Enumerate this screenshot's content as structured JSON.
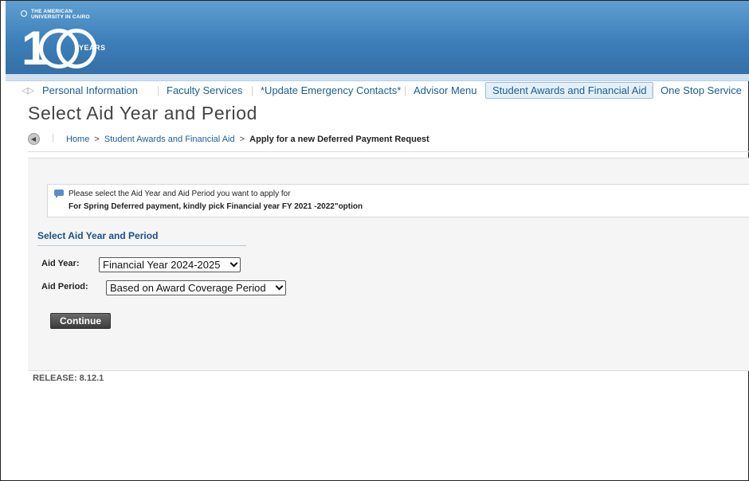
{
  "header": {
    "university_line1": "THE AMERICAN",
    "university_line2": "UNIVERSITY IN CAIRO",
    "centennial_years": "YEARS",
    "brand_color": "#3d7fb9"
  },
  "nav": {
    "items": [
      {
        "label": "Personal Information"
      },
      {
        "label": "Faculty Services"
      },
      {
        "label": "*Update Emergency Contacts*"
      },
      {
        "label": "Advisor Menu"
      },
      {
        "label": "Student Awards and Financial Aid",
        "active": true
      },
      {
        "label": "One Stop Service"
      }
    ]
  },
  "page": {
    "title": "Select Aid Year and Period"
  },
  "breadcrumb": {
    "home": "Home",
    "section": "Student Awards and Financial Aid",
    "current": "Apply for a new Deferred Payment Request",
    "separator": ">"
  },
  "info": {
    "line1": "Please select the Aid Year and Aid Period you want to apply for",
    "line2": "For Spring Deferred payment, kindly pick Financial year FY 2021 -2022\"option"
  },
  "form": {
    "section_title": "Select Aid Year and Period",
    "aid_year": {
      "label": "Aid Year:",
      "selected": "Financial Year 2024-2025"
    },
    "aid_period": {
      "label": "Aid Period:",
      "selected": "Based on Award Coverage Period"
    },
    "continue_label": "Continue"
  },
  "footer": {
    "release": "RELEASE: 8.12.1"
  }
}
